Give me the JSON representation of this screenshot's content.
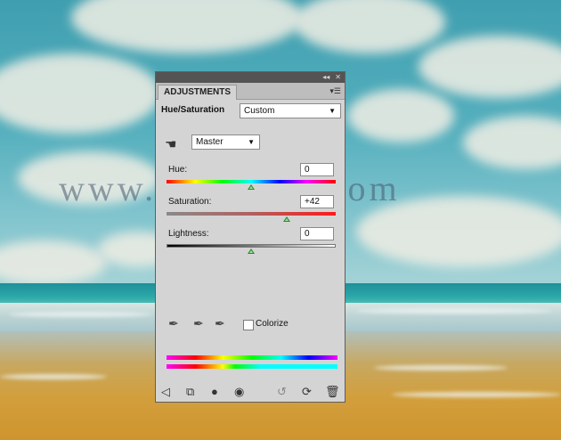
{
  "panel": {
    "tab_label": "ADJUSTMENTS",
    "adjustment_name": "Hue/Saturation",
    "preset_value": "Custom",
    "channel_value": "Master",
    "hue_label": "Hue:",
    "hue_value": "0",
    "saturation_label": "Saturation:",
    "saturation_value": "+42",
    "lightness_label": "Lightness:",
    "lightness_value": "0",
    "colorize_label": "Colorize",
    "colorize_checked": false
  },
  "sliders": {
    "hue": {
      "value": 0,
      "min": -180,
      "max": 180
    },
    "saturation": {
      "value": 42,
      "min": -100,
      "max": 100
    },
    "lightness": {
      "value": 0,
      "min": -100,
      "max": 100
    }
  },
  "background": {
    "watermark_text": "www.psd-dude.com"
  },
  "icons": [
    "collapse-arrows-icon",
    "close-icon",
    "panel-menu-icon",
    "hand-adjust-icon",
    "eyedropper-icon",
    "eyedropper-plus-icon",
    "eyedropper-minus-icon",
    "back-arrow-icon",
    "expand-view-icon",
    "clip-layer-icon",
    "visibility-eye-icon",
    "previous-state-icon",
    "reset-icon",
    "trash-icon"
  ],
  "colors": {
    "panel_bg": "#d4d4d4",
    "titlebar_bg": "#545454",
    "thumb": "#2d8a2d"
  }
}
